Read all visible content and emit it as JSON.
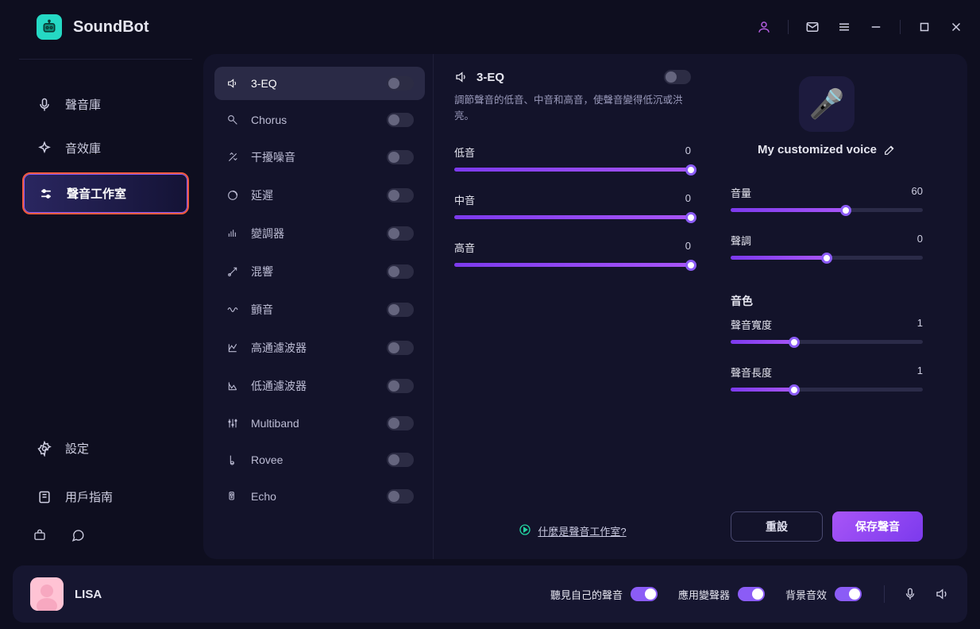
{
  "app": {
    "name": "SoundBot"
  },
  "sidebar": {
    "items": [
      {
        "label": "聲音庫"
      },
      {
        "label": "音效庫"
      },
      {
        "label": "聲音工作室"
      }
    ],
    "settings_label": "設定",
    "guide_label": "用戶指南"
  },
  "effects": [
    {
      "label": "3-EQ",
      "on": false,
      "selected": true,
      "icon": "eq"
    },
    {
      "label": "Chorus",
      "on": false,
      "icon": "chorus"
    },
    {
      "label": "干擾噪音",
      "on": false,
      "icon": "noise"
    },
    {
      "label": "延遲",
      "on": false,
      "icon": "delay"
    },
    {
      "label": "變調器",
      "on": false,
      "icon": "pitch"
    },
    {
      "label": "混響",
      "on": false,
      "icon": "reverb"
    },
    {
      "label": "顫音",
      "on": false,
      "icon": "tremolo"
    },
    {
      "label": "高通濾波器",
      "on": false,
      "icon": "hpf"
    },
    {
      "label": "低通濾波器",
      "on": false,
      "icon": "lpf"
    },
    {
      "label": "Multiband",
      "on": false,
      "icon": "multiband"
    },
    {
      "label": "Rovee",
      "on": false,
      "icon": "rovee"
    },
    {
      "label": "Echo",
      "on": false,
      "icon": "echo"
    }
  ],
  "detail": {
    "title": "3-EQ",
    "description": "調節聲音的低音、中音和高音，使聲音變得低沉或洪亮。",
    "sliders": [
      {
        "label": "低音",
        "value": 0,
        "fill": 100
      },
      {
        "label": "中音",
        "value": 0,
        "fill": 100
      },
      {
        "label": "高音",
        "value": 0,
        "fill": 100
      }
    ],
    "help_link": "什麼是聲音工作室?"
  },
  "voice": {
    "name": "My customized voice",
    "volume_label": "音量",
    "volume_value": 60,
    "volume_fill": 60,
    "pitch_label": "聲調",
    "pitch_value": 0,
    "pitch_fill": 50,
    "timbre_section": "音色",
    "width_label": "聲音寬度",
    "width_value": 1,
    "width_fill": 33,
    "length_label": "聲音長度",
    "length_value": 1,
    "length_fill": 33,
    "reset_label": "重設",
    "save_label": "保存聲音"
  },
  "footer": {
    "username": "LISA",
    "toggles": [
      {
        "label": "聽見自己的聲音",
        "on": true
      },
      {
        "label": "應用變聲器",
        "on": true
      },
      {
        "label": "背景音效",
        "on": true
      }
    ]
  }
}
